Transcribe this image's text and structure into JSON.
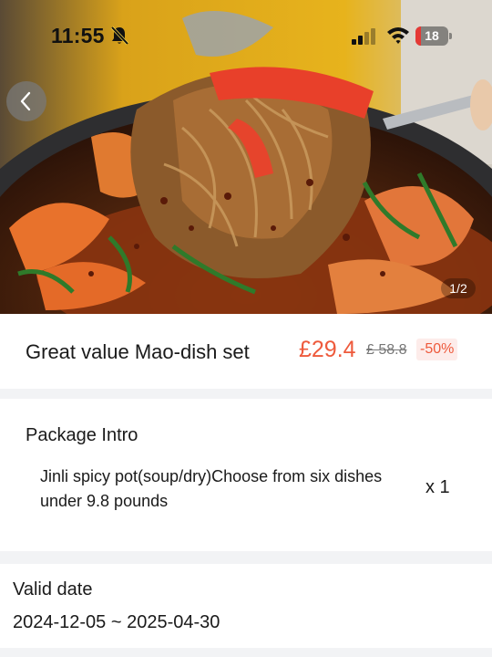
{
  "status_bar": {
    "time": "11:55",
    "battery_level": "18",
    "battery_fraction": 0.18,
    "icons": [
      "bell-slash-icon",
      "cellular-signal-icon",
      "wifi-icon",
      "battery-icon"
    ]
  },
  "hero": {
    "image_index": "1/2",
    "back_icon": "chevron-left-icon"
  },
  "product": {
    "title": "Great value Mao-dish set",
    "price": "£29.4",
    "original_price": "£ 58.8",
    "discount": "-50%"
  },
  "package": {
    "heading": "Package Intro",
    "items": [
      {
        "name": "Jinli spicy pot(soup/dry)Choose from six dishes under 9.8 pounds",
        "quantity": "x 1"
      }
    ]
  },
  "validity": {
    "heading": "Valid date",
    "range": "2024-12-05 ~ 2025-04-30"
  },
  "colors": {
    "price_accent": "#ee5a3c",
    "discount_bg": "#fdecea",
    "page_bg": "#f2f3f5",
    "battery_low": "#e53935"
  }
}
